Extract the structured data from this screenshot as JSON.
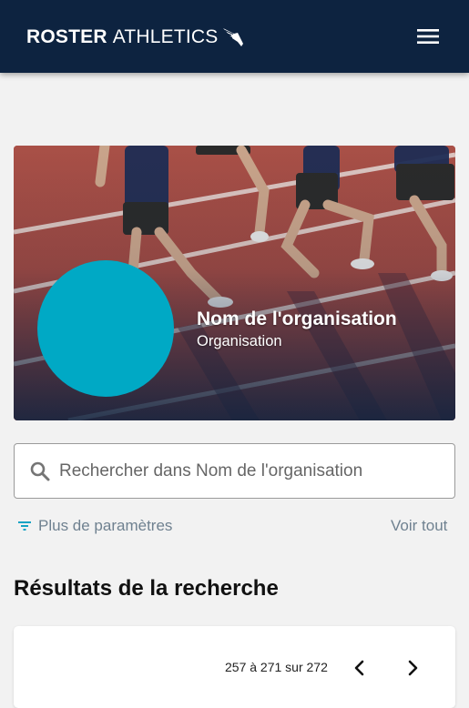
{
  "header": {
    "logo_bold": "ROSTER",
    "logo_light": "ATHLETICS",
    "menu_icon": "hamburger-menu-icon",
    "background": "#0d2340"
  },
  "organization": {
    "name": "Nom de l'organisation",
    "type": "Organisation",
    "avatar_color": "#00a9c5"
  },
  "search": {
    "placeholder": "Rechercher dans Nom de l'organisation",
    "value": "",
    "icon": "search-icon"
  },
  "filters": {
    "more_params_label": "Plus de paramètres",
    "see_all_label": "Voir tout",
    "icon": "filter-icon"
  },
  "results": {
    "title": "Résultats de la recherche",
    "pagination": {
      "text": "257 à 271 sur 272",
      "prev_icon": "chevron-left-icon",
      "next_icon": "chevron-right-icon"
    }
  }
}
